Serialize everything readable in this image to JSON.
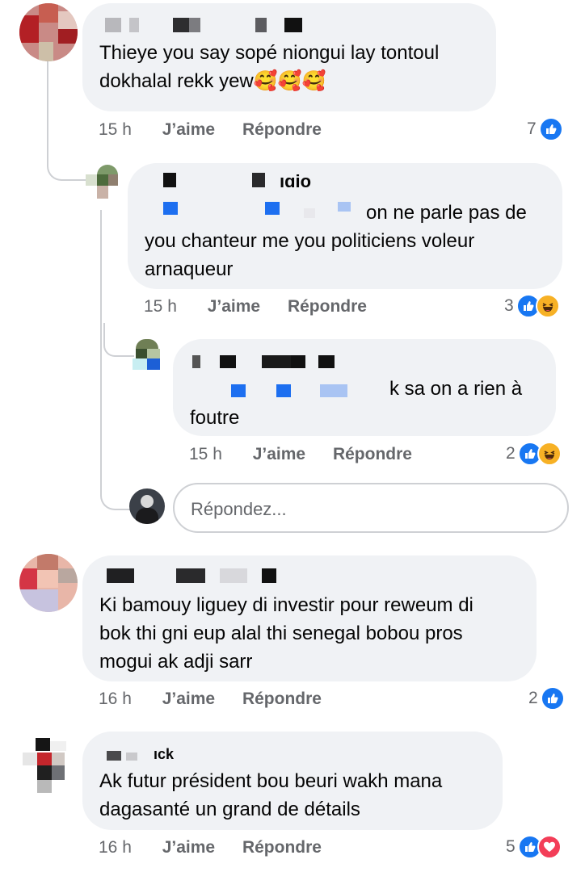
{
  "comments": [
    {
      "text": "Thieye you say sopé niongui lay tontoul\ndokhalal rekk yew🥰🥰🥰",
      "time": "15 h",
      "like_label": "J’aime",
      "reply_label": "Répondre",
      "reaction_count": "7",
      "reactions": [
        "like"
      ]
    },
    {
      "name_fragment": "ıgio",
      "text_tail": "on ne parle pas de",
      "text_rest": "you chanteur me you politiciens voleur\narnaqueur",
      "time": "15 h",
      "like_label": "J’aime",
      "reply_label": "Répondre",
      "reaction_count": "3",
      "reactions": [
        "like",
        "haha"
      ]
    },
    {
      "text_tail": "k sa on a rien à",
      "text_rest": "foutre",
      "time": "15 h",
      "like_label": "J’aime",
      "reply_label": "Répondre",
      "reaction_count": "2",
      "reactions": [
        "like",
        "haha"
      ]
    },
    {
      "text": "Ki bamouy liguey di investir pour reweum di\nbok thi gni eup alal thi senegal bobou pros\nmogui ak adji sarr",
      "time": "16 h",
      "like_label": "J’aime",
      "reply_label": "Répondre",
      "reaction_count": "2",
      "reactions": [
        "like"
      ]
    },
    {
      "name_fragment": "ıck",
      "text": "Ak futur président bou beuri wakh mana\ndagasanté un grand de détails",
      "time": "16 h",
      "like_label": "J’aime",
      "reply_label": "Répondre",
      "reaction_count": "5",
      "reactions": [
        "like",
        "love"
      ]
    }
  ],
  "reply_box": {
    "placeholder": "Répondez..."
  },
  "colors": {
    "bubble": "#f0f2f5",
    "meta": "#65676b",
    "like": "#1877f2",
    "haha": "#f7b125",
    "love": "#f33e58",
    "thread": "#ced0d4"
  },
  "icons": {
    "like": "thumbs-up-icon",
    "haha": "laughing-face-icon",
    "love": "heart-icon"
  }
}
